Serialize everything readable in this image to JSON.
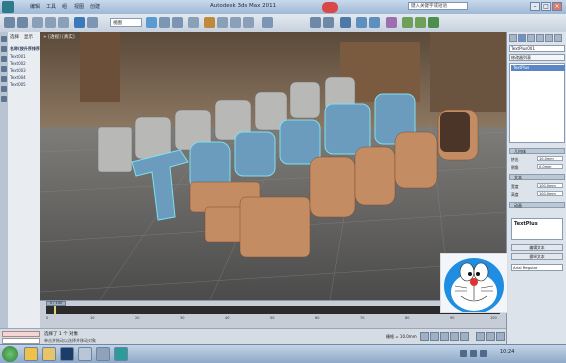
{
  "title_bar": {
    "app_title": "Autodesk 3ds Max 2011",
    "menu_items": [
      "编辑",
      "工具",
      "组",
      "视图",
      "创建"
    ],
    "help_search_placeholder": "键入关键字或短语",
    "minimize": "–",
    "maximize": "□",
    "close": "×"
  },
  "toolbar": {
    "ref_coord": "视图",
    "icons": [
      "undo-icon",
      "redo-icon",
      "link-icon",
      "unlink-icon",
      "bind-icon",
      "select-icon",
      "select-name-icon",
      "rect-select-icon",
      "window-icon",
      "move-icon",
      "rotate-icon",
      "scale-icon",
      "pivot-icon",
      "snap-icon",
      "angle-snap-icon",
      "percent-snap-icon",
      "spinner-snap-icon",
      "named-sets-icon",
      "mirror-icon",
      "align-icon",
      "layers-icon",
      "curve-editor-icon",
      "schematic-icon",
      "material-editor-icon",
      "render-setup-icon",
      "render-icon"
    ]
  },
  "explorer": {
    "tabs": [
      "选择",
      "显示"
    ],
    "rows": [
      "名称(按升序排序)",
      "Text001",
      "Text002",
      "Text003",
      "Text004",
      "Text005"
    ]
  },
  "viewport": {
    "label": "+ [透视] [真实]"
  },
  "timeline": {
    "slider_label": "0 / 100",
    "ticks": [
      "0",
      "10",
      "20",
      "30",
      "40",
      "50",
      "60",
      "70",
      "80",
      "90",
      "100"
    ]
  },
  "status": {
    "maxscript": "",
    "selection_text": "选择了 1 个 对象",
    "hint": "单击并拖动以选择并移动对象",
    "grid": "栅格 = 10.0mm"
  },
  "panel": {
    "object_name": "TextPlus001",
    "modifier_list": "修改器列表",
    "stack_item": "TextPlus",
    "rollouts": [
      "几何体",
      "文本",
      "动画"
    ],
    "fields": [
      {
        "label": "挤出",
        "value": "10.0mm"
      },
      {
        "label": "倒角",
        "value": "0.0mm"
      },
      {
        "label": "宽度",
        "value": "100.0mm"
      },
      {
        "label": "高度",
        "value": "100.0mm"
      }
    ],
    "preview_text": "TextPlus",
    "font": "Arial Regular",
    "edit_button": "编辑文本",
    "manipulate_button": "操纵文本"
  },
  "taskbar": {
    "apps": [
      "ie-icon",
      "folder-icon",
      "photoshop-icon",
      "player-icon",
      "image-icon",
      "3dsmax-icon"
    ],
    "clock": "10:24"
  },
  "colors": {
    "selection_outline": "#7ee0f0",
    "grey_text": "#b8b8b6",
    "blue_text": "#6b9bbd",
    "orange_text": "#c48c62"
  }
}
